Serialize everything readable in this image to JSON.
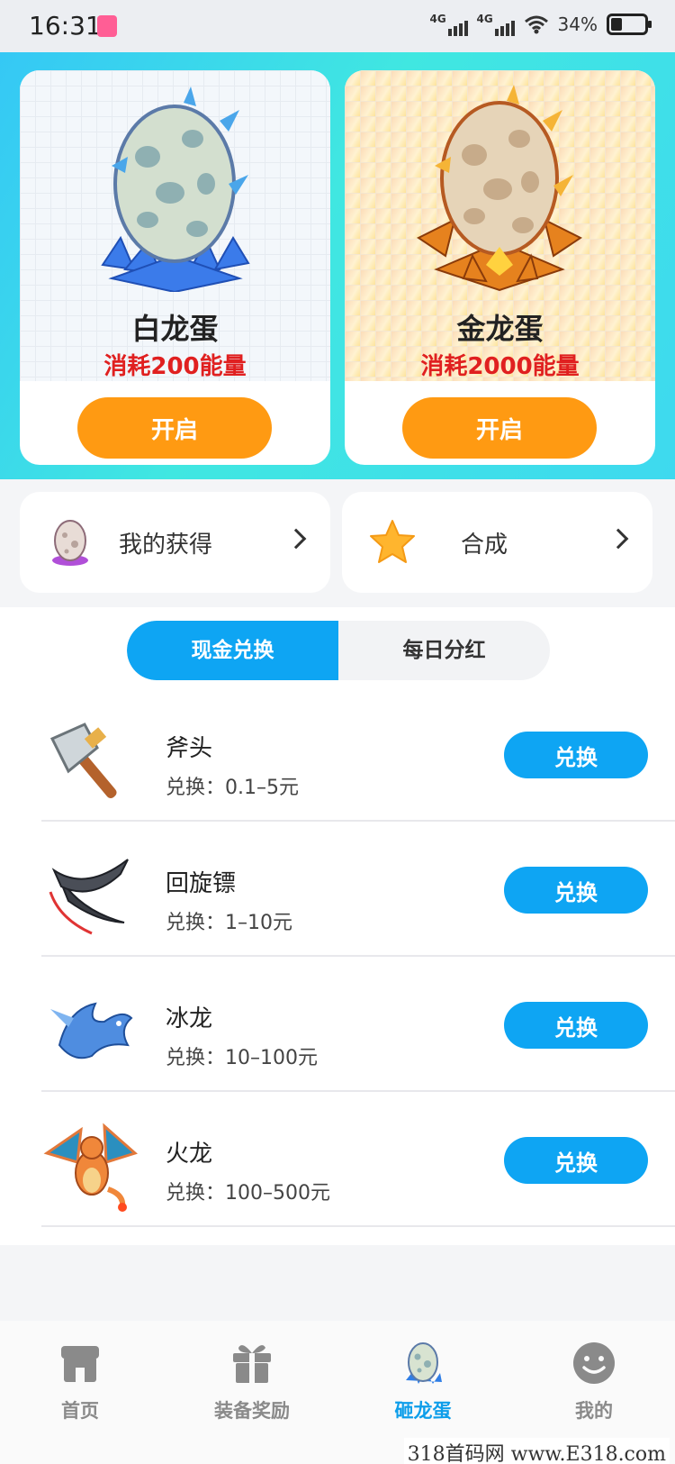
{
  "status_bar": {
    "time": "16:31",
    "net1": "4G",
    "net2": "4G",
    "battery": "34%",
    "battery_level": 0.34
  },
  "eggs": [
    {
      "name": "白龙蛋",
      "cost": "消耗200能量",
      "button": "开启",
      "icon": "white-dragon-egg-icon"
    },
    {
      "name": "金龙蛋",
      "cost": "消耗2000能量",
      "button": "开启",
      "icon": "gold-dragon-egg-icon"
    }
  ],
  "quick": {
    "mine": {
      "label": "我的获得",
      "icon": "purple-egg-icon"
    },
    "compose": {
      "label": "合成",
      "icon": "star-icon"
    }
  },
  "tabs": [
    {
      "label": "现金兑换",
      "active": true
    },
    {
      "label": "每日分红",
      "active": false
    }
  ],
  "items": [
    {
      "name": "斧头",
      "range": "兑换：0.1–5元",
      "button": "兑换",
      "icon": "axe-icon"
    },
    {
      "name": "回旋镖",
      "range": "兑换：1–10元",
      "button": "兑换",
      "icon": "boomerang-icon"
    },
    {
      "name": "冰龙",
      "range": "兑换：10–100元",
      "button": "兑换",
      "icon": "ice-dragon-icon"
    },
    {
      "name": "火龙",
      "range": "兑换：100–500元",
      "button": "兑换",
      "icon": "fire-dragon-icon"
    }
  ],
  "nav": [
    {
      "label": "首页",
      "icon": "shop-icon",
      "active": false
    },
    {
      "label": "装备奖励",
      "icon": "gift-icon",
      "active": false
    },
    {
      "label": "砸龙蛋",
      "icon": "dragon-egg-icon",
      "active": true
    },
    {
      "label": "我的",
      "icon": "smiley-icon",
      "active": false
    }
  ],
  "watermark": "318首码网 www.E318.com",
  "colors": {
    "accent_blue": "#0ea5f3",
    "orange": "#ff9a12",
    "cost_red": "#e02020"
  }
}
